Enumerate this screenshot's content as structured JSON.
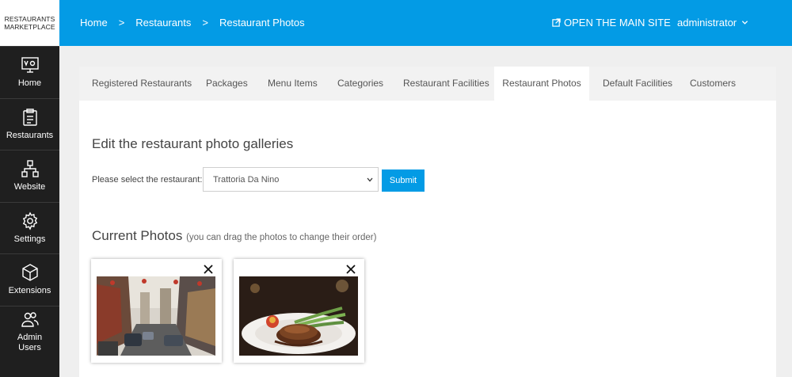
{
  "brand": {
    "line1": "RESTAURANTS",
    "line2": "MARKETPLACE"
  },
  "sidebar": {
    "items": [
      {
        "label": "Home",
        "icon": "presentation-icon"
      },
      {
        "label": "Restaurants",
        "icon": "clipboard-icon"
      },
      {
        "label": "Website",
        "icon": "sitemap-icon"
      },
      {
        "label": "Settings",
        "icon": "gear-icon"
      },
      {
        "label": "Extensions",
        "icon": "cube-icon"
      },
      {
        "label_line1": "Admin",
        "label_line2": "Users",
        "icon": "users-icon"
      }
    ]
  },
  "topbar": {
    "breadcrumb": [
      "Home",
      "Restaurants",
      "Restaurant Photos"
    ],
    "separator": ">",
    "open_site": "OPEN THE MAIN SITE",
    "user": "administrator"
  },
  "tabs": [
    "Registered Restaurants",
    "Packages",
    "Menu Items",
    "Categories",
    "Restaurant Facilities",
    "Restaurant Photos",
    "Default Facilities",
    "Customers"
  ],
  "active_tab": "Restaurant Photos",
  "gallery": {
    "title": "Edit the restaurant photo galleries",
    "select_label": "Please select the restaurant:",
    "selected_restaurant": "Trattoria Da Nino",
    "submit_label": "Submit",
    "photos_title": "Current Photos",
    "photos_hint": "(you can drag the photos to change their order)",
    "photos": [
      {
        "name": "street-photo"
      },
      {
        "name": "food-photo"
      }
    ]
  },
  "colors": {
    "accent": "#039be5",
    "sidebar_bg": "#1f1f1f"
  }
}
